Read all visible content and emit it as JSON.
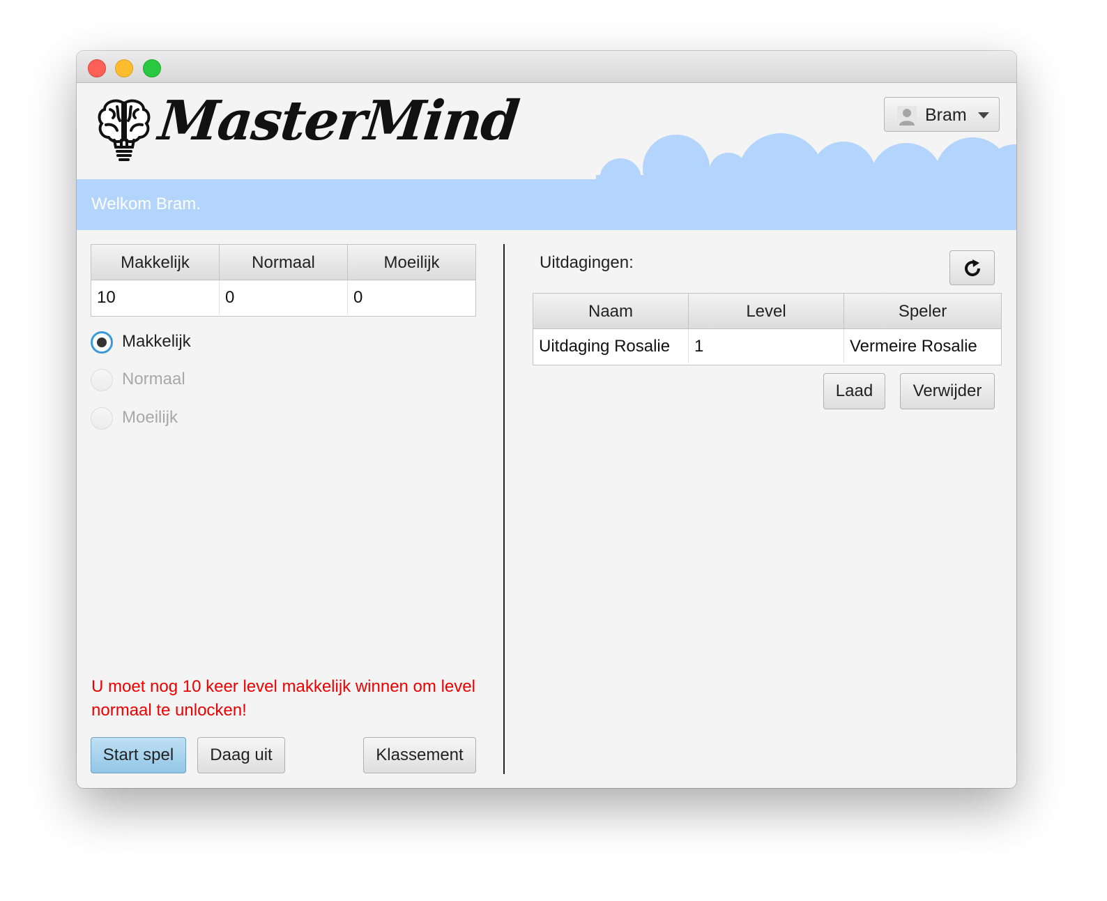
{
  "app": {
    "logo_text": "MasterMind",
    "user_menu": {
      "name": "Bram"
    },
    "welcome": "Welkom Bram."
  },
  "levels_table": {
    "headers": [
      "Makkelijk",
      "Normaal",
      "Moeilijk"
    ],
    "values": [
      "10",
      "0",
      "0"
    ]
  },
  "difficulty": {
    "selected": "Makkelijk",
    "options": [
      {
        "label": "Makkelijk",
        "enabled": true
      },
      {
        "label": "Normaal",
        "enabled": false
      },
      {
        "label": "Moeilijk",
        "enabled": false
      }
    ]
  },
  "unlock_message": "U moet nog 10 keer level makkelijk winnen om level normaal te unlocken!",
  "buttons": {
    "start": "Start spel",
    "challenge": "Daag uit",
    "ranking": "Klassement",
    "load": "Laad",
    "delete": "Verwijder"
  },
  "challenges": {
    "label": "Uitdagingen:",
    "headers": [
      "Naam",
      "Level",
      "Speler"
    ],
    "rows": [
      [
        "Uitdaging Rosalie",
        "1",
        "Vermeire Rosalie"
      ]
    ]
  },
  "colors": {
    "banner": "#b3d4fc",
    "warning": "#ee0000",
    "primary_button": "#a9d3ee",
    "accent": "#3a9ad9"
  },
  "icons": [
    "brain-bulb-icon",
    "user-icon",
    "chevron-down-icon",
    "refresh-icon"
  ]
}
